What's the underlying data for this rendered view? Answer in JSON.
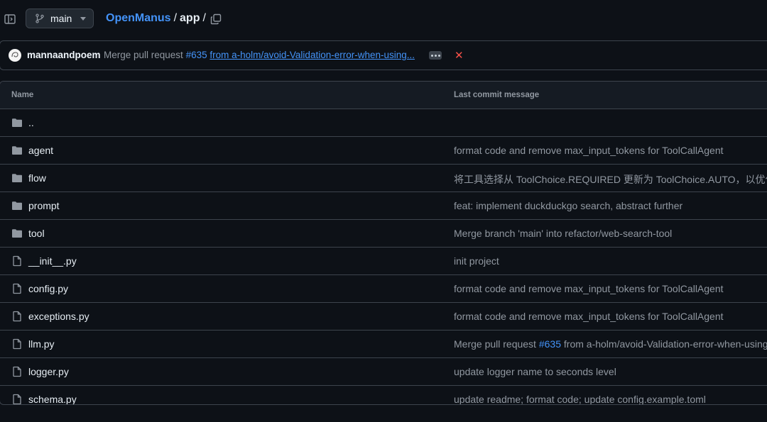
{
  "header": {
    "branch": "main",
    "repo": "OpenManus",
    "separator": "/",
    "current_dir": "app",
    "trailing_separator": "/"
  },
  "commit": {
    "author": "mannaandpoem",
    "message_prefix": "Merge pull request",
    "pr_number": "#635",
    "message_link": "from a-holm/avoid-Validation-error-when-using..."
  },
  "table": {
    "headers": {
      "name": "Name",
      "message": "Last commit message"
    },
    "rows": [
      {
        "name": "..",
        "type": "folder",
        "message": ""
      },
      {
        "name": "agent",
        "type": "folder",
        "message": "format code and remove max_input_tokens for ToolCallAgent"
      },
      {
        "name": "flow",
        "type": "folder",
        "message": "将工具选择从 ToolChoice.REQUIRED 更新为 ToolChoice.AUTO，以优化规划代"
      },
      {
        "name": "prompt",
        "type": "folder",
        "message": "feat: implement duckduckgo search, abstract further"
      },
      {
        "name": "tool",
        "type": "folder",
        "message": "Merge branch 'main' into refactor/web-search-tool"
      },
      {
        "name": "__init__.py",
        "type": "file",
        "message": "init project"
      },
      {
        "name": "config.py",
        "type": "file",
        "message": "format code and remove max_input_tokens for ToolCallAgent"
      },
      {
        "name": "exceptions.py",
        "type": "file",
        "message": "format code and remove max_input_tokens for ToolCallAgent"
      },
      {
        "name": "llm.py",
        "type": "file",
        "message_prefix": "Merge pull request",
        "pr_number": "#635",
        "message_suffix": "from a-holm/avoid-Validation-error-when-using..."
      },
      {
        "name": "logger.py",
        "type": "file",
        "message": "update logger name to seconds level"
      },
      {
        "name": "schema.py",
        "type": "file",
        "message": "update readme; format code; update config.example.toml"
      }
    ]
  },
  "colors": {
    "accent": "#4493f8",
    "background": "#0d1117",
    "error": "#f85149"
  }
}
